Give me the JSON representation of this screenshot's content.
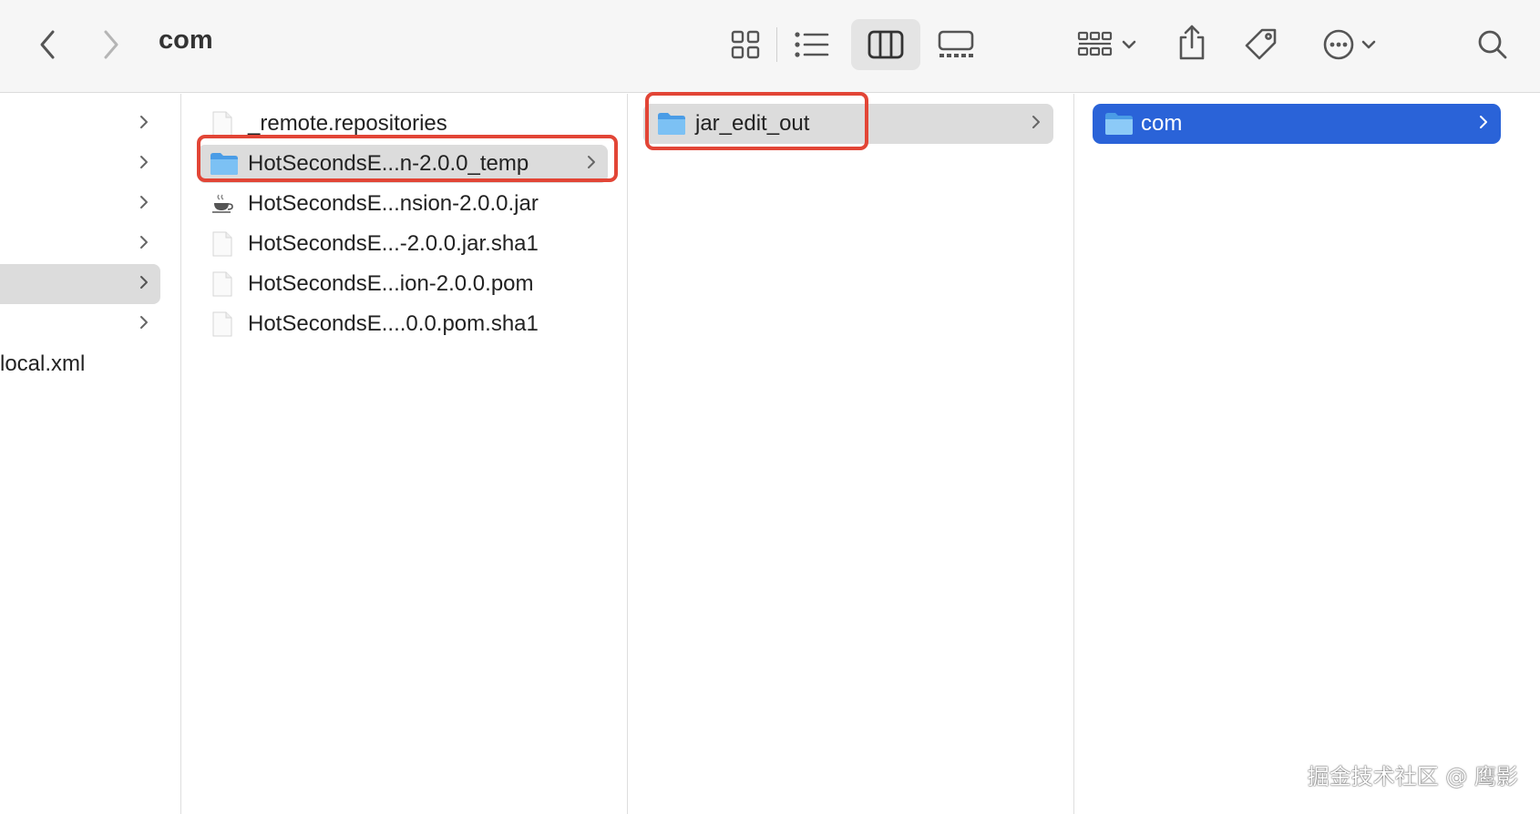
{
  "toolbar": {
    "title": "com",
    "icons": [
      "back-icon",
      "forward-icon",
      "icon-view-icon",
      "list-view-icon",
      "column-view-icon",
      "gallery-view-icon",
      "group-icon",
      "share-icon",
      "tag-icon",
      "more-icon",
      "search-icon"
    ],
    "active_view": "column"
  },
  "column0": {
    "rows": [
      {
        "label": "",
        "has_chevron": true
      },
      {
        "label": "",
        "has_chevron": true
      },
      {
        "label": "",
        "has_chevron": true
      },
      {
        "label": "",
        "has_chevron": true
      },
      {
        "label": "",
        "has_chevron": true,
        "selected": true
      },
      {
        "label": "",
        "has_chevron": true
      },
      {
        "label": "local.xml",
        "has_chevron": false
      }
    ]
  },
  "column1": {
    "rows": [
      {
        "label": "_remote.repositories",
        "icon": "document-icon"
      },
      {
        "label": "HotSecondsE...n-2.0.0_temp",
        "icon": "folder-icon",
        "selected": true,
        "has_chevron": true
      },
      {
        "label": "HotSecondsE...nsion-2.0.0.jar",
        "icon": "java-icon"
      },
      {
        "label": "HotSecondsE...-2.0.0.jar.sha1",
        "icon": "document-icon"
      },
      {
        "label": "HotSecondsE...ion-2.0.0.pom",
        "icon": "document-icon"
      },
      {
        "label": "HotSecondsE....0.0.pom.sha1",
        "icon": "document-icon"
      }
    ]
  },
  "column2": {
    "rows": [
      {
        "label": "jar_edit_out",
        "icon": "folder-icon",
        "selected": true,
        "has_chevron": true
      }
    ]
  },
  "column3": {
    "rows": [
      {
        "label": "com",
        "icon": "folder-icon",
        "selected": true,
        "has_chevron": true
      }
    ]
  },
  "watermark": "掘金技术社区 @ 鹰影",
  "colors": {
    "selection_blue": "#2a63d8",
    "selection_gray": "#dcdcdc",
    "highlight_red": "#e24536",
    "folder_blue": "#6fb8ef"
  }
}
